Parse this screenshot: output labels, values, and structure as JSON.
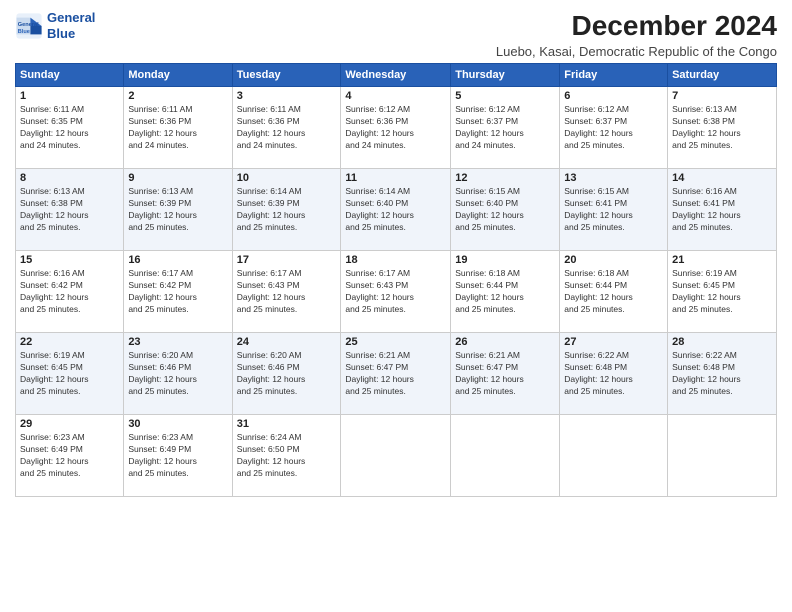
{
  "logo": {
    "line1": "General",
    "line2": "Blue"
  },
  "title": "December 2024",
  "subtitle": "Luebo, Kasai, Democratic Republic of the Congo",
  "days_of_week": [
    "Sunday",
    "Monday",
    "Tuesday",
    "Wednesday",
    "Thursday",
    "Friday",
    "Saturday"
  ],
  "weeks": [
    [
      {
        "day": "1",
        "rise": "6:11 AM",
        "set": "6:35 PM",
        "hours": "12",
        "minutes": "24"
      },
      {
        "day": "2",
        "rise": "6:11 AM",
        "set": "6:36 PM",
        "hours": "12",
        "minutes": "24"
      },
      {
        "day": "3",
        "rise": "6:11 AM",
        "set": "6:36 PM",
        "hours": "12",
        "minutes": "24"
      },
      {
        "day": "4",
        "rise": "6:12 AM",
        "set": "6:36 PM",
        "hours": "12",
        "minutes": "24"
      },
      {
        "day": "5",
        "rise": "6:12 AM",
        "set": "6:37 PM",
        "hours": "12",
        "minutes": "24"
      },
      {
        "day": "6",
        "rise": "6:12 AM",
        "set": "6:37 PM",
        "hours": "12",
        "minutes": "25"
      },
      {
        "day": "7",
        "rise": "6:13 AM",
        "set": "6:38 PM",
        "hours": "12",
        "minutes": "25"
      }
    ],
    [
      {
        "day": "8",
        "rise": "6:13 AM",
        "set": "6:38 PM",
        "hours": "12",
        "minutes": "25"
      },
      {
        "day": "9",
        "rise": "6:13 AM",
        "set": "6:39 PM",
        "hours": "12",
        "minutes": "25"
      },
      {
        "day": "10",
        "rise": "6:14 AM",
        "set": "6:39 PM",
        "hours": "12",
        "minutes": "25"
      },
      {
        "day": "11",
        "rise": "6:14 AM",
        "set": "6:40 PM",
        "hours": "12",
        "minutes": "25"
      },
      {
        "day": "12",
        "rise": "6:15 AM",
        "set": "6:40 PM",
        "hours": "12",
        "minutes": "25"
      },
      {
        "day": "13",
        "rise": "6:15 AM",
        "set": "6:41 PM",
        "hours": "12",
        "minutes": "25"
      },
      {
        "day": "14",
        "rise": "6:16 AM",
        "set": "6:41 PM",
        "hours": "12",
        "minutes": "25"
      }
    ],
    [
      {
        "day": "15",
        "rise": "6:16 AM",
        "set": "6:42 PM",
        "hours": "12",
        "minutes": "25"
      },
      {
        "day": "16",
        "rise": "6:17 AM",
        "set": "6:42 PM",
        "hours": "12",
        "minutes": "25"
      },
      {
        "day": "17",
        "rise": "6:17 AM",
        "set": "6:43 PM",
        "hours": "12",
        "minutes": "25"
      },
      {
        "day": "18",
        "rise": "6:17 AM",
        "set": "6:43 PM",
        "hours": "12",
        "minutes": "25"
      },
      {
        "day": "19",
        "rise": "6:18 AM",
        "set": "6:44 PM",
        "hours": "12",
        "minutes": "25"
      },
      {
        "day": "20",
        "rise": "6:18 AM",
        "set": "6:44 PM",
        "hours": "12",
        "minutes": "25"
      },
      {
        "day": "21",
        "rise": "6:19 AM",
        "set": "6:45 PM",
        "hours": "12",
        "minutes": "25"
      }
    ],
    [
      {
        "day": "22",
        "rise": "6:19 AM",
        "set": "6:45 PM",
        "hours": "12",
        "minutes": "25"
      },
      {
        "day": "23",
        "rise": "6:20 AM",
        "set": "6:46 PM",
        "hours": "12",
        "minutes": "25"
      },
      {
        "day": "24",
        "rise": "6:20 AM",
        "set": "6:46 PM",
        "hours": "12",
        "minutes": "25"
      },
      {
        "day": "25",
        "rise": "6:21 AM",
        "set": "6:47 PM",
        "hours": "12",
        "minutes": "25"
      },
      {
        "day": "26",
        "rise": "6:21 AM",
        "set": "6:47 PM",
        "hours": "12",
        "minutes": "25"
      },
      {
        "day": "27",
        "rise": "6:22 AM",
        "set": "6:48 PM",
        "hours": "12",
        "minutes": "25"
      },
      {
        "day": "28",
        "rise": "6:22 AM",
        "set": "6:48 PM",
        "hours": "12",
        "minutes": "25"
      }
    ],
    [
      {
        "day": "29",
        "rise": "6:23 AM",
        "set": "6:49 PM",
        "hours": "12",
        "minutes": "25"
      },
      {
        "day": "30",
        "rise": "6:23 AM",
        "set": "6:49 PM",
        "hours": "12",
        "minutes": "25"
      },
      {
        "day": "31",
        "rise": "6:24 AM",
        "set": "6:50 PM",
        "hours": "12",
        "minutes": "25"
      },
      null,
      null,
      null,
      null
    ]
  ]
}
